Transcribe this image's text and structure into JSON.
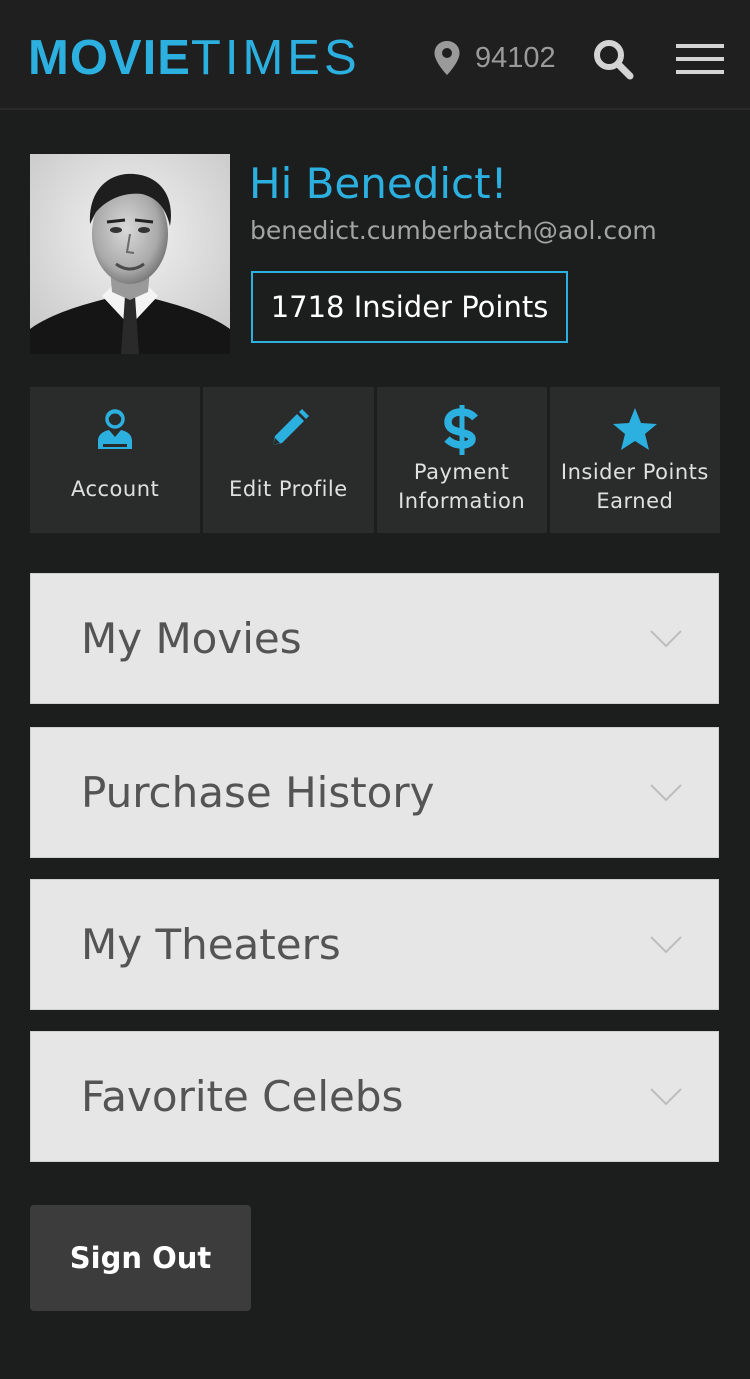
{
  "header": {
    "logo_bold": "MOVIE",
    "logo_thin": "TIMES",
    "zip": "94102"
  },
  "profile": {
    "greeting": "Hi Benedict!",
    "email": "benedict.cumberbatch@aol.com",
    "points": "1718 Insider Points"
  },
  "tiles": [
    {
      "icon": "account-icon",
      "label_line1": "Account",
      "label_line2": ""
    },
    {
      "icon": "pencil-icon",
      "label_line1": "Edit Profile",
      "label_line2": ""
    },
    {
      "icon": "dollar-icon",
      "label_line1": "Payment",
      "label_line2": "Information"
    },
    {
      "icon": "star-icon",
      "label_line1": "Insider Points",
      "label_line2": "Earned"
    }
  ],
  "sections": [
    {
      "title": "My Movies"
    },
    {
      "title": "Purchase History"
    },
    {
      "title": "My Theaters"
    },
    {
      "title": "Favorite Celebs"
    }
  ],
  "signout_label": "Sign Out",
  "colors": {
    "accent": "#2cb0e0",
    "background": "#1c1d1d",
    "tile": "#2a2b2b",
    "accordion": "#e6e6e6"
  }
}
